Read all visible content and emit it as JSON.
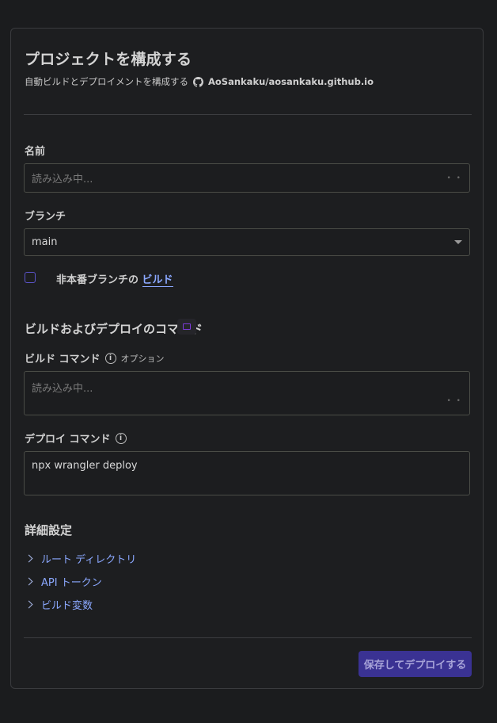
{
  "header": {
    "title": "プロジェクトを構成する",
    "subtitle": "自動ビルドとデプロイメントを構成する",
    "repo": "AoSankaku/aosankaku.github.io",
    "repo_icon": "github-icon"
  },
  "name_field": {
    "label": "名前",
    "placeholder": "読み込み中..."
  },
  "branch_field": {
    "label": "ブランチ",
    "value": "main"
  },
  "non_production": {
    "label_prefix": "非本番ブランチの",
    "link": "ビルド",
    "checked": false
  },
  "build_deploy": {
    "section_title": "ビルドおよびデプロイのコマンド",
    "build_label": "ビルド コマンド",
    "build_optional": "オプション",
    "build_placeholder": "読み込み中...",
    "deploy_label": "デプロイ コマンド",
    "deploy_value": "npx wrangler deploy"
  },
  "advanced": {
    "title": "詳細設定",
    "items": [
      "ルート ディレクトリ",
      "API トークン",
      "ビルド変数"
    ]
  },
  "footer": {
    "save_label": "保存してデプロイする"
  },
  "colors": {
    "accent": "#3a3293",
    "link": "#8ba8ff",
    "background": "#1b1c1e"
  }
}
